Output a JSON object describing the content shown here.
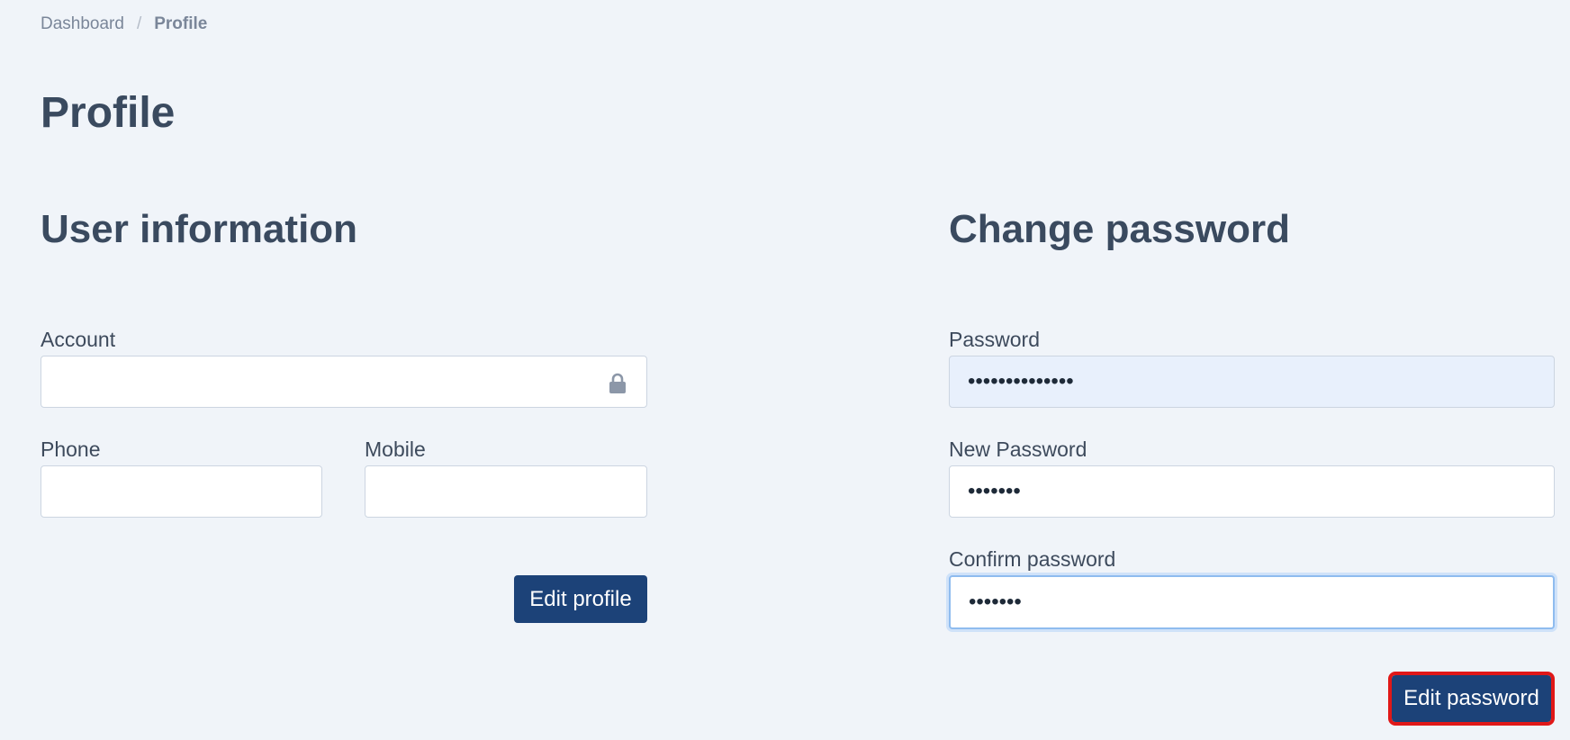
{
  "breadcrumb": {
    "items": [
      "Dashboard",
      "Profile"
    ],
    "separator": "/"
  },
  "page": {
    "title": "Profile"
  },
  "user_info": {
    "title": "User information",
    "account_label": "Account",
    "account_value": "",
    "phone_label": "Phone",
    "phone_value": "",
    "mobile_label": "Mobile",
    "mobile_value": "",
    "edit_button": "Edit profile",
    "lock_icon": "lock-icon"
  },
  "change_password": {
    "title": "Change password",
    "password_label": "Password",
    "password_value": "••••••••••••••",
    "new_password_label": "New Password",
    "new_password_value": "•••••••",
    "confirm_password_label": "Confirm password",
    "confirm_password_value": "•••••••",
    "edit_button": "Edit password"
  },
  "colors": {
    "background": "#f0f4f9",
    "primary_button": "#1c4278",
    "heading": "#3a4a5f",
    "highlight_outline": "#e01818",
    "focus_ring": "#8fbcef",
    "autofill_bg": "#e8f0fc"
  }
}
